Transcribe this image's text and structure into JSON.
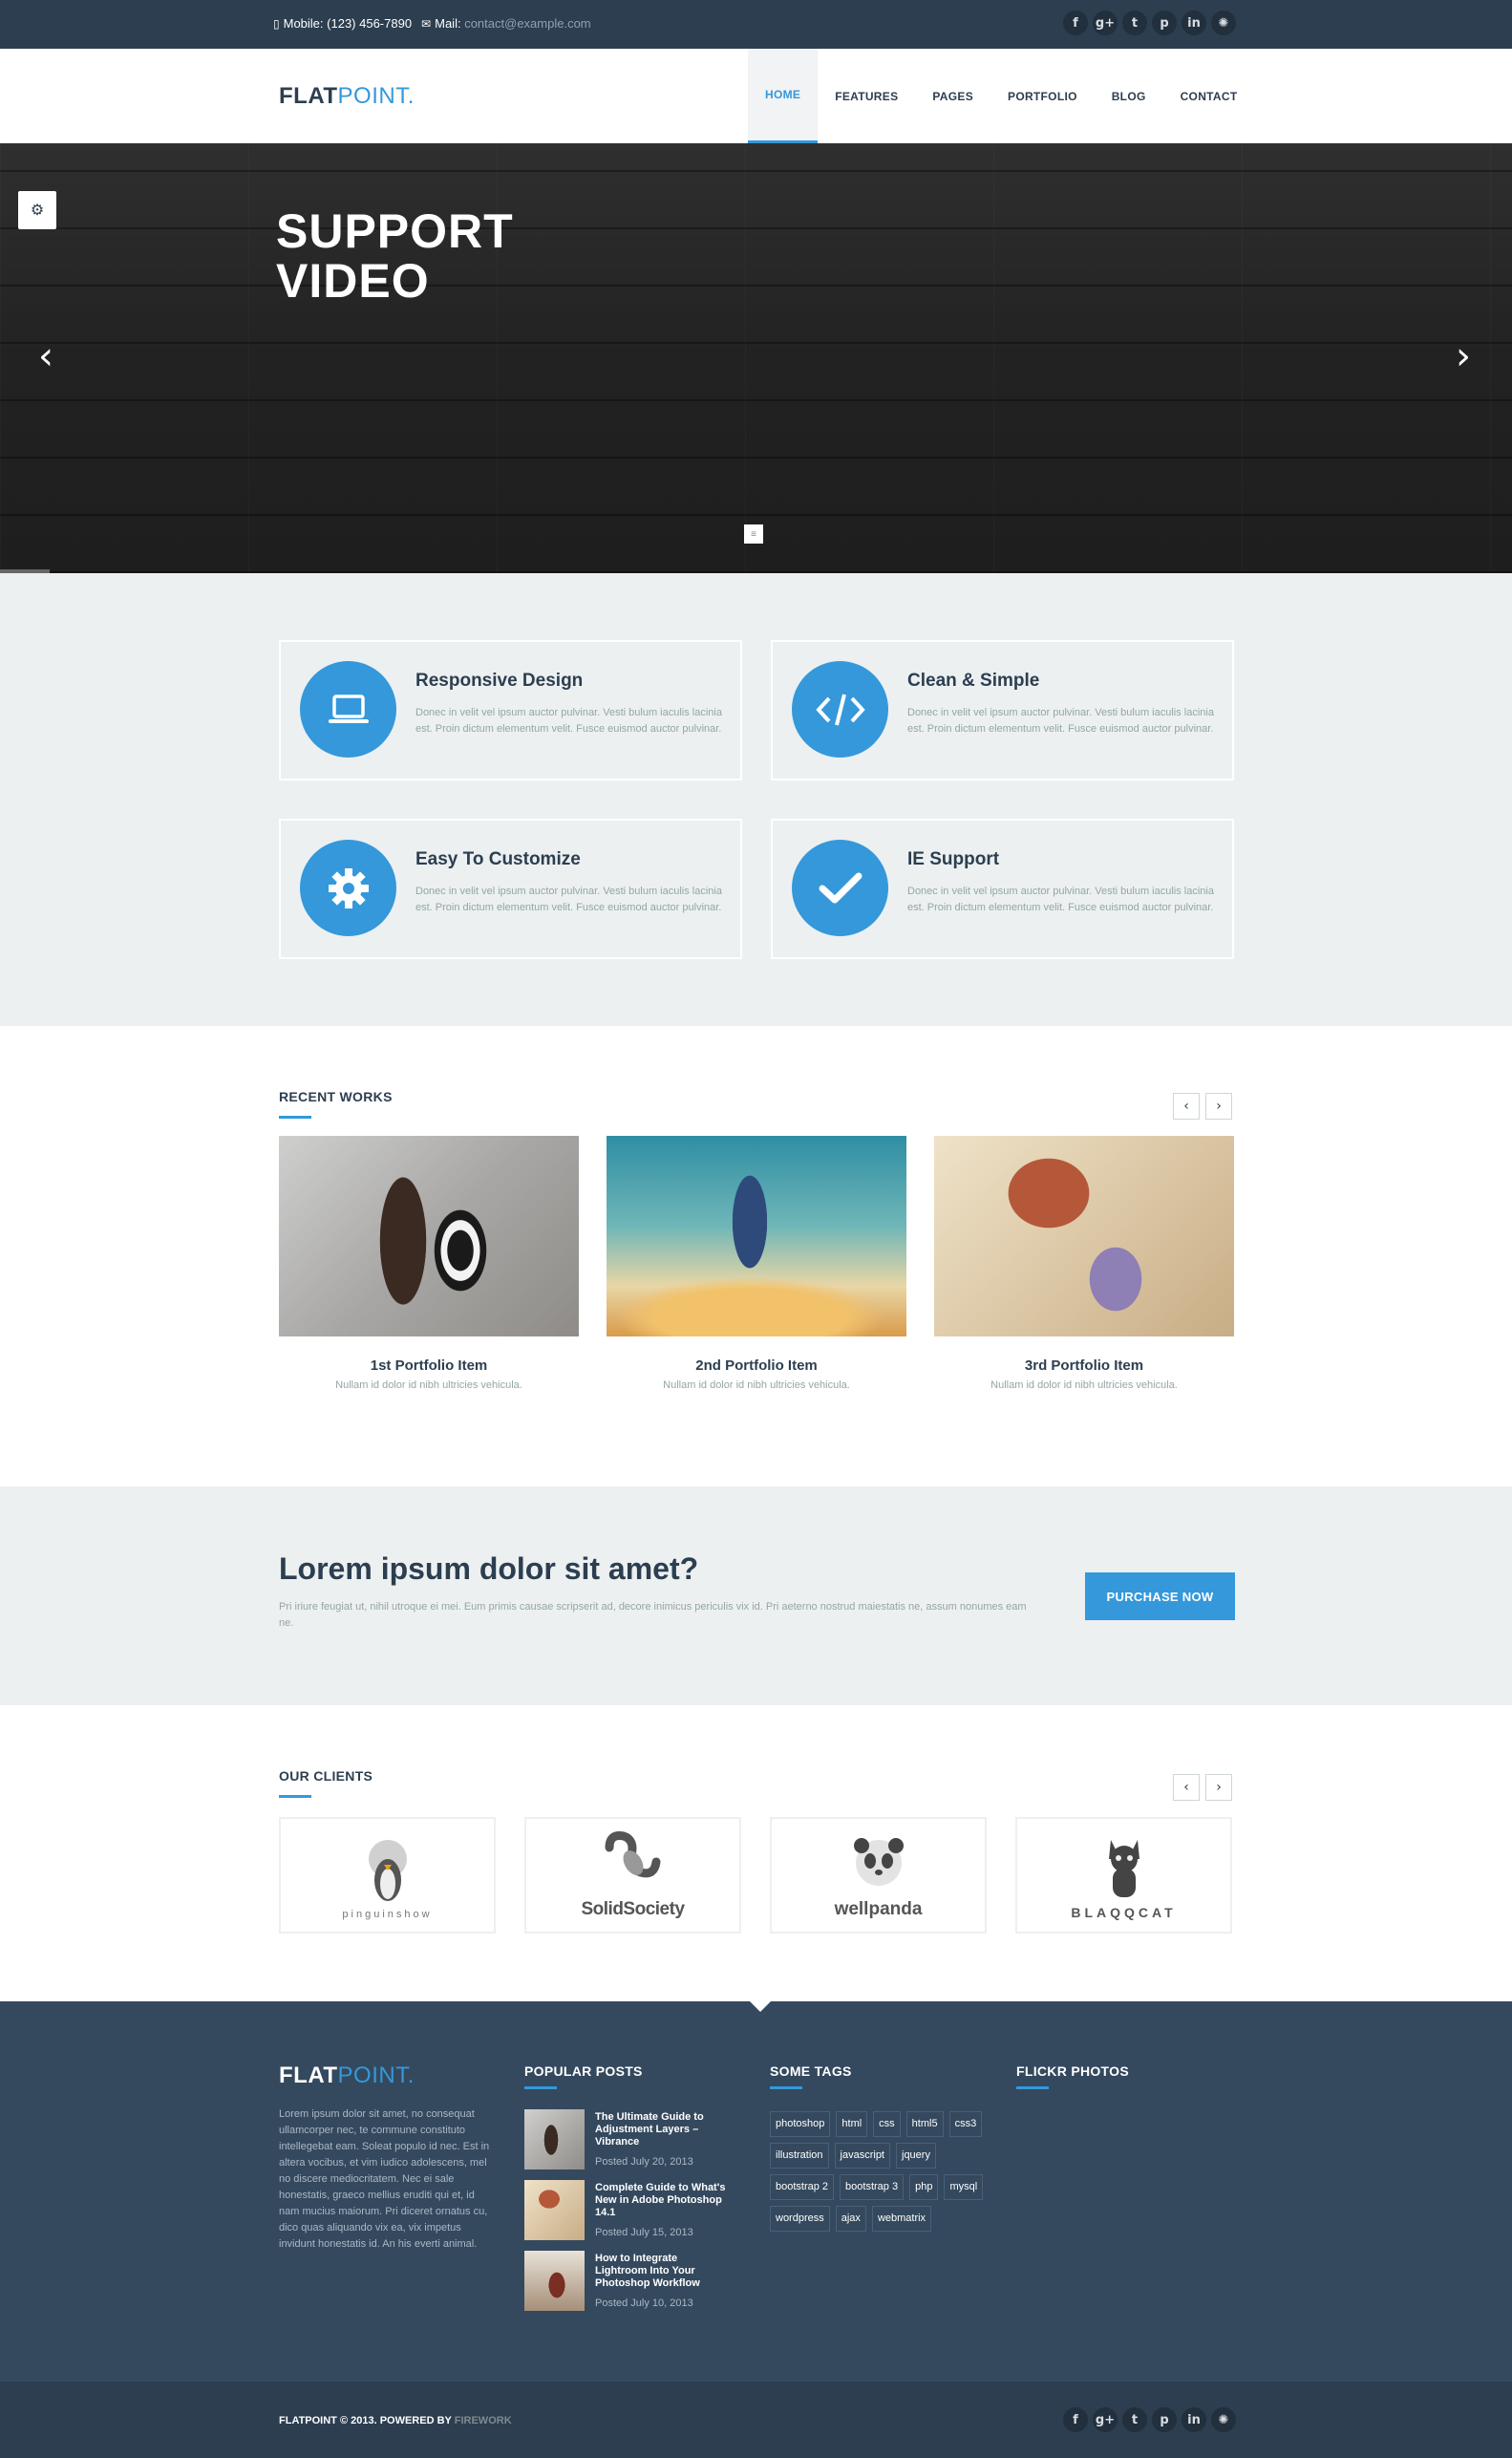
{
  "topbar": {
    "mobile_label": "Mobile:",
    "mobile_value": "(123) 456-7890",
    "mail_label": "Mail:",
    "mail_value": "contact@example.com",
    "social": [
      "f",
      "g+",
      "t",
      "p",
      "in",
      "✺"
    ]
  },
  "brand": {
    "bold": "FLAT",
    "light": "POINT."
  },
  "nav": {
    "items": [
      {
        "label": "HOME"
      },
      {
        "label": "FEATURES"
      },
      {
        "label": "PAGES"
      },
      {
        "label": "PORTFOLIO"
      },
      {
        "label": "BLOG"
      },
      {
        "label": "CONTACT"
      }
    ],
    "active": "HOME"
  },
  "hero": {
    "title_line1": "SUPPORT",
    "title_line2": "VIDEO",
    "prev_icon": "chevron-left-icon",
    "next_icon": "chevron-right-icon",
    "settings_icon": "gears-icon"
  },
  "features": [
    {
      "title": "Responsive Design",
      "icon": "laptop-icon",
      "text": "Donec in velit vel ipsum auctor pulvinar. Vesti bulum iaculis lacinia est. Proin dictum elementum velit. Fusce euismod auctor pulvinar."
    },
    {
      "title": "Clean & Simple",
      "icon": "code-icon",
      "text": "Donec in velit vel ipsum auctor pulvinar. Vesti bulum iaculis lacinia est. Proin dictum elementum velit. Fusce euismod auctor pulvinar."
    },
    {
      "title": "Easy To Customize",
      "icon": "gear-icon",
      "text": "Donec in velit vel ipsum auctor pulvinar. Vesti bulum iaculis lacinia est. Proin dictum elementum velit. Fusce euismod auctor pulvinar."
    },
    {
      "title": "IE Support",
      "icon": "check-icon",
      "text": "Donec in velit vel ipsum auctor pulvinar. Vesti bulum iaculis lacinia est. Proin dictum elementum velit. Fusce euismod auctor pulvinar."
    }
  ],
  "works": {
    "title": "RECENT WORKS",
    "items": [
      {
        "title": "1st Portfolio Item",
        "text": "Nullam id dolor id nibh ultricies vehicula."
      },
      {
        "title": "2nd Portfolio Item",
        "text": "Nullam id dolor id nibh ultricies vehicula."
      },
      {
        "title": "3rd Portfolio Item",
        "text": "Nullam id dolor id nibh ultricies vehicula."
      }
    ]
  },
  "cta": {
    "heading": "Lorem ipsum dolor sit amet?",
    "text": "Pri iriure feugiat ut, nihil utroque ei mei. Eum primis causae scripserit ad, decore inimicus periculis vix id. Pri aeterno nostrud maiestatis ne, assum nonumes eam ne.",
    "button": "PURCHASE NOW"
  },
  "clients": {
    "title": "OUR CLIENTS",
    "items": [
      {
        "name": "pinguinshow"
      },
      {
        "name": "SolidSociety"
      },
      {
        "name": "wellpanda"
      },
      {
        "name": "BLAQQCAT"
      }
    ]
  },
  "footer": {
    "about": "Lorem ipsum dolor sit amet, no consequat ullamcorper nec, te commune constituto intellegebat eam. Soleat populo id nec. Est in altera vocibus, et vim iudico adolescens, mel no discere mediocritatem. Nec ei sale honestatis, graeco mellius eruditi qui et, id nam mucius maiorum. Pri diceret ornatus cu, dico quas aliquando vix ea, vix impetus invidunt honestatis id. An his everti animal.",
    "popular_title": "POPULAR POSTS",
    "posts": [
      {
        "title": "The Ultimate Guide to Adjustment Layers – Vibrance",
        "date": "Posted July 20, 2013"
      },
      {
        "title": "Complete Guide to What's New in Adobe Photoshop 14.1",
        "date": "Posted July 15, 2013"
      },
      {
        "title": "How to Integrate Lightroom Into Your Photoshop Workflow",
        "date": "Posted July 10, 2013"
      }
    ],
    "tags_title": "SOME TAGS",
    "tags": [
      "photoshop",
      "html",
      "css",
      "html5",
      "css3",
      "illustration",
      "javascript",
      "jquery",
      "bootstrap 2",
      "bootstrap 3",
      "php",
      "mysql",
      "wordpress",
      "ajax",
      "webmatrix"
    ],
    "flickr_title": "FLICKR PHOTOS"
  },
  "bottombar": {
    "copy": "FLATPOINT © 2013. POWERED BY",
    "powered_by": "FIREWORK"
  }
}
